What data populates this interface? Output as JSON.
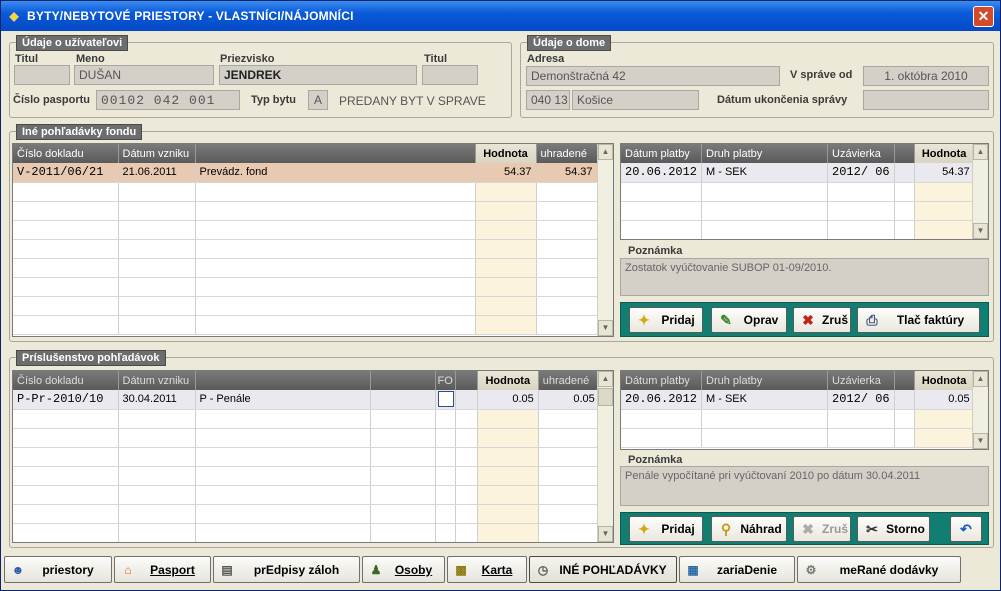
{
  "title": "BYTY/NEBYTOVÉ PRIESTORY - VLASTNÍCI/NÁJOMNÍCI",
  "user": {
    "legend": "Údaje o užívateľovi",
    "titul_label": "Titul",
    "meno_label": "Meno",
    "priezvisko_label": "Priezvisko",
    "titul2_label": "Titul",
    "titul": "",
    "meno": "DUŠAN",
    "priezvisko": "JENDREK",
    "titul2": "",
    "pasport_label": "Číslo pasportu",
    "pasport": "00102 042 001",
    "typ_label": "Typ bytu",
    "typ": "A",
    "typ_text": "PREDANY BYT V SPRAVE"
  },
  "house": {
    "legend": "Údaje o dome",
    "adresa_label": "Adresa",
    "adresa": "Demonštračná 42",
    "psc": "040 13",
    "mesto": "Košice",
    "sprava_od_label": "V správe od",
    "sprava_od": "1. októbra 2010",
    "ukoncenie_label": "Dátum ukončenia správy",
    "ukoncenie": ""
  },
  "fund": {
    "legend": "Iné pohľadávky fondu",
    "headers": [
      "Číslo dokladu",
      "Dátum vzniku",
      "",
      "Hodnota",
      "uhradené"
    ],
    "rows": [
      {
        "doc": "V-2011/06/21",
        "date": "21.06.2011",
        "desc": "Prevádz. fond",
        "value": "54.37",
        "paid": "54.37"
      }
    ],
    "payments_headers": [
      "Dátum platby",
      "Druh platby",
      "Uzávierka",
      "",
      "Hodnota"
    ],
    "payments": [
      {
        "date": "20.06.2012",
        "type": "M - SEK",
        "close": "2012/ 06",
        "value": "54.37"
      }
    ],
    "note_label": "Poznámka",
    "note": "Zostatok vyúčtovanie SUBOP 01-09/2010.",
    "buttons": {
      "add": "Pridaj",
      "edit": "Oprav",
      "cancel": "Zruš",
      "print": "Tlač faktúry"
    }
  },
  "acc": {
    "legend": "Príslušenstvo pohľadávok",
    "headers": [
      "Číslo dokladu",
      "Dátum vzniku",
      "",
      "",
      "FO",
      "",
      "Hodnota",
      "uhradené"
    ],
    "rows": [
      {
        "doc": "P-Pr-2010/10",
        "date": "30.04.2011",
        "desc": "P - Penále",
        "value": "0.05",
        "paid": "0.05"
      }
    ],
    "payments_headers": [
      "Dátum platby",
      "Druh platby",
      "Uzávierka",
      "",
      "Hodnota"
    ],
    "payments": [
      {
        "date": "20.06.2012",
        "type": "M - SEK",
        "close": "2012/ 06",
        "value": "0.05"
      }
    ],
    "note_label": "Poznámka",
    "note": "Penále vypočítané pri vyúčtovaní 2010 po dátum 30.04.2011",
    "buttons": {
      "add": "Pridaj",
      "replace": "Náhrad",
      "cancel": "Zruš",
      "storno": "Storno"
    }
  },
  "tabs": [
    "priestory",
    "Pasport",
    "prEdpisy záloh",
    "Osoby",
    "Karta",
    "INÉ POHĽADÁVKY",
    "zariaDenie",
    "meRané dodávky"
  ],
  "colors": {
    "titlebar": "#0549c6",
    "buttonbar": "#117e72",
    "selected_row": "#e8c9b2",
    "value_col": "#fbf3dc"
  }
}
